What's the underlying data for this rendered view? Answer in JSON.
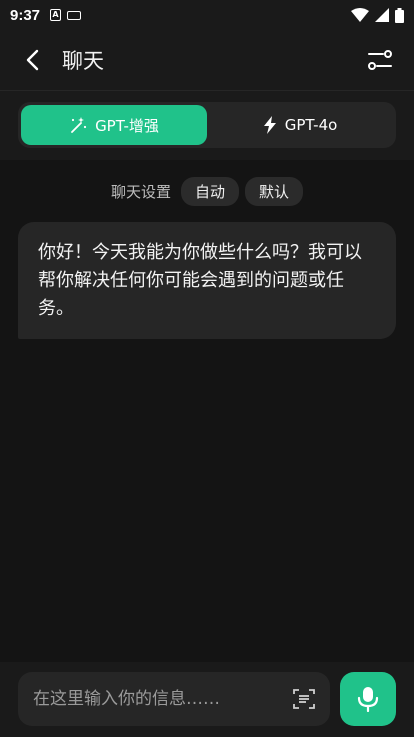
{
  "status_bar": {
    "time": "9:37",
    "notification_icon_letter": "A"
  },
  "app_bar": {
    "title": "聊天",
    "back_icon": "chevron-left-icon",
    "settings_icon": "sliders-icon"
  },
  "model_tabs": [
    {
      "label": "GPT-增强",
      "icon": "magic-wand-icon",
      "active": true
    },
    {
      "label": "GPT-4o",
      "icon": "lightning-icon",
      "active": false
    }
  ],
  "chat_settings": {
    "label": "聊天设置",
    "chips": [
      "自动",
      "默认"
    ]
  },
  "messages": [
    {
      "role": "assistant",
      "text": "你好！今天我能为你做些什么吗？我可以帮你解决任何你可能会遇到的问题或任务。"
    }
  ],
  "composer": {
    "placeholder": "在这里输入你的信息……",
    "value": ""
  },
  "colors": {
    "accent": "#20c28a",
    "background": "#141414",
    "surface": "#262626"
  }
}
